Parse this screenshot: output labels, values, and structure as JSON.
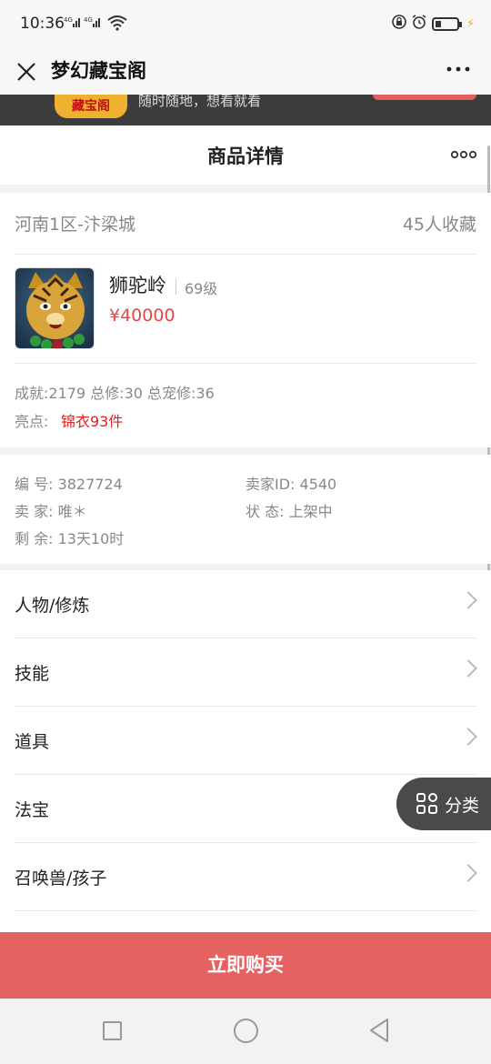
{
  "status_bar": {
    "time": "10:36",
    "signal": "4G᛫ıl 4G᛫ıl",
    "wifi_icon": "wifi-icon"
  },
  "window": {
    "title": "梦幻藏宝阁",
    "close_icon": "close-icon",
    "more_icon": "more-icon"
  },
  "banner": {
    "logo": "藏宝阁",
    "slogan": "随时随地，想看就看"
  },
  "header": {
    "title": "商品详情"
  },
  "item": {
    "server": "河南1区-汴梁城",
    "favorites": "45人收藏",
    "name": "狮驼岭",
    "level": "69级",
    "price": "¥40000",
    "stats": "成就:2179 总修:30 总宠修:36",
    "highlight_label": "亮点:",
    "highlight_value": "锦衣93件"
  },
  "meta": {
    "id": "编 号: 3827724",
    "seller_id": "卖家ID: 4540",
    "seller": "卖 家: 唯＊",
    "status": "状 态: 上架中",
    "remaining": "剩 余: 13天10时"
  },
  "sections": [
    "人物/修炼",
    "技能",
    "道具",
    "法宝",
    "召唤兽/孩子"
  ],
  "float_button": {
    "label": "分类"
  },
  "buy_button": {
    "label": "立即购买"
  },
  "colors": {
    "accent": "#e46262",
    "price": "#e04a4a",
    "highlight": "#e02020"
  }
}
